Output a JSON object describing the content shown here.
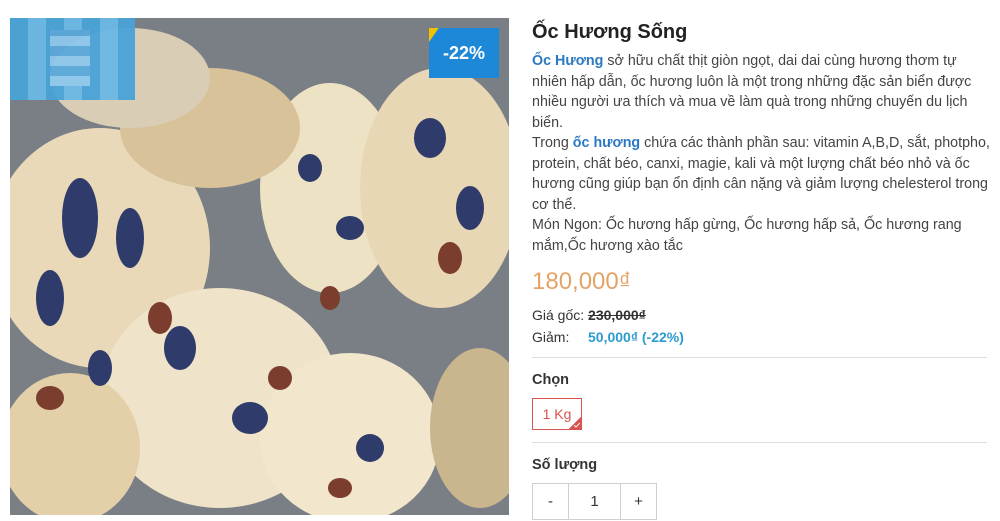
{
  "product": {
    "title": "Ốc Hương Sống",
    "discount_badge": "-22%",
    "description": {
      "p1_highlight": "Ốc Hương",
      "p1_text": " sở hữu chất thịt giòn ngọt, dai dai cùng hương thơm tự nhiên hấp dẫn, ốc hương luôn là một trong những đặc sản biển được nhiều người ưa thích và mua về làm quà trong những chuyến du lịch biển.",
      "p2_prefix": "Trong ",
      "p2_highlight": "ốc hương",
      "p2_text": " chứa các thành phần sau: vitamin A,B,D, sắt, photpho, protein, chất béo, canxi, magie, kali và một lượng chất béo nhỏ và ốc hương cũng giúp bạn ổn định cân nặng và giảm lượng chelesterol trong cơ thể.",
      "p3_text": "Món Ngon: Ốc hương hấp gừng, Ốc hương hấp sả, Ốc hương rang mắm,Ốc hương xào tắc"
    },
    "price": "180,000₫",
    "original_price_label": "Giá gốc:",
    "original_price": "230,000₫",
    "discount_label": "Giảm:",
    "discount_value": "50,000₫ (-22%)"
  },
  "options": {
    "label": "Chọn",
    "selected": "1 Kg"
  },
  "quantity": {
    "label": "Số lượng",
    "minus": "-",
    "value": "1",
    "plus": "+"
  },
  "colors": {
    "accent_blue": "#2b79c2",
    "price_orange": "#e4a366",
    "option_red": "#d9534f",
    "badge_blue": "#1e88d8"
  }
}
